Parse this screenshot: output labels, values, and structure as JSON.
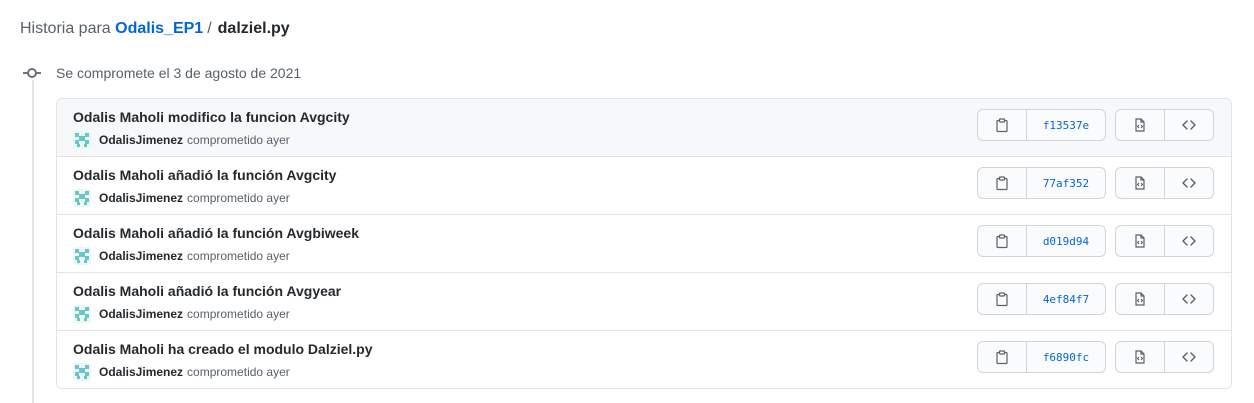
{
  "header": {
    "prefix": "Historia para",
    "repo": "Odalis_EP1",
    "separator": "/",
    "file": "dalziel.py"
  },
  "timeline": {
    "date_label": "Se compromete el 3 de agosto de 2021"
  },
  "commits": [
    {
      "message": "Odalis Maholi modifico la funcion Avgcity",
      "author": "OdalisJimenez",
      "when": "comprometido ayer",
      "sha": "f13537e"
    },
    {
      "message": "Odalis Maholi añadió la función Avgcity",
      "author": "OdalisJimenez",
      "when": "comprometido ayer",
      "sha": "77af352"
    },
    {
      "message": "Odalis Maholi añadió la función Avgbiweek",
      "author": "OdalisJimenez",
      "when": "comprometido ayer",
      "sha": "d019d94"
    },
    {
      "message": "Odalis Maholi añadió la función Avgyear",
      "author": "OdalisJimenez",
      "when": "comprometido ayer",
      "sha": "4ef84f7"
    },
    {
      "message": "Odalis Maholi ha creado el modulo Dalziel.py",
      "author": "OdalisJimenez",
      "when": "comprometido ayer",
      "sha": "f6890fc"
    }
  ],
  "icons": {
    "commit": "git-commit-icon",
    "avatar": "identicon-avatar",
    "copy": "clipboard-icon",
    "browse": "file-code-icon",
    "code": "code-icon"
  },
  "colors": {
    "link": "#0366d6",
    "text": "#24292e",
    "muted": "#586069",
    "border": "#e1e4e8",
    "avatar": "#6cc5c5"
  }
}
